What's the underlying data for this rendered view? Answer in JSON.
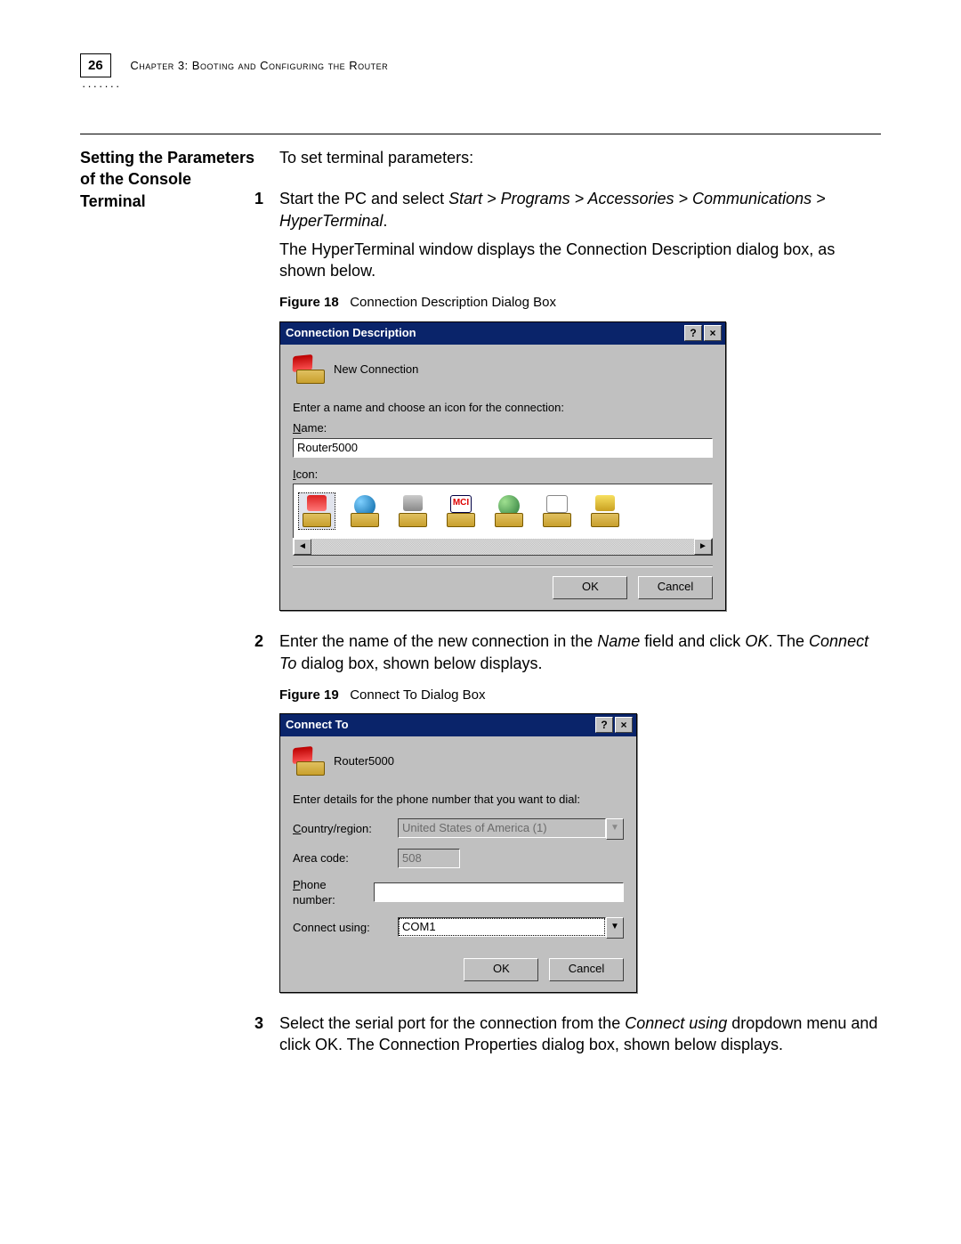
{
  "header": {
    "page_number": "26",
    "chapter_line": "Chapter 3: Booting and Configuring the Router"
  },
  "sidebar_heading": "Setting the Parameters of the Console Terminal",
  "intro": "To set terminal parameters:",
  "steps": {
    "s1": {
      "num": "1",
      "text_a": "Start the PC and select ",
      "path": "Start > Programs > Accessories > Communications > HyperTerminal",
      "text_b": ".",
      "text_c": "The HyperTerminal window displays the Connection Description dialog box, as shown below."
    },
    "s2": {
      "num": "2",
      "text_a": "Enter the name of the new connection in the ",
      "em1": "Name",
      "text_b": " field and click ",
      "em2": "OK",
      "text_c": ". The ",
      "em3": "Connect To",
      "text_d": " dialog box, shown below displays."
    },
    "s3": {
      "num": "3",
      "text_a": "Select the serial port for the connection from the ",
      "em1": "Connect using",
      "text_b": " dropdown menu and click OK. The Connection Properties dialog box, shown below displays."
    }
  },
  "figures": {
    "f18": {
      "label": "Figure 18",
      "caption": "Connection Description Dialog Box"
    },
    "f19": {
      "label": "Figure 19",
      "caption": "Connect To Dialog Box"
    }
  },
  "dialog1": {
    "title": "Connection Description",
    "help_glyph": "?",
    "close_glyph": "×",
    "header_text": "New Connection",
    "prompt": "Enter a name and choose an icon for the connection:",
    "name_label": "Name:",
    "name_value": "Router5000",
    "icon_label": "Icon:",
    "scroll_left": "◄",
    "scroll_right": "►",
    "ok": "OK",
    "cancel": "Cancel",
    "icons": [
      "phone-red",
      "globe-blue",
      "modem-gray",
      "mci-logo",
      "globe-green",
      "document",
      "phone-yellow"
    ]
  },
  "dialog2": {
    "title": "Connect To",
    "help_glyph": "?",
    "close_glyph": "×",
    "header_text": "Router5000",
    "prompt": "Enter details for the phone number that you want to dial:",
    "country_label": "Country/region:",
    "country_value": "United States of America (1)",
    "area_label": "Area code:",
    "area_value": "508",
    "phone_label": "Phone number:",
    "phone_value": "",
    "connect_label": "Connect using:",
    "connect_value": "COM1",
    "dd_glyph": "▼",
    "ok": "OK",
    "cancel": "Cancel"
  }
}
